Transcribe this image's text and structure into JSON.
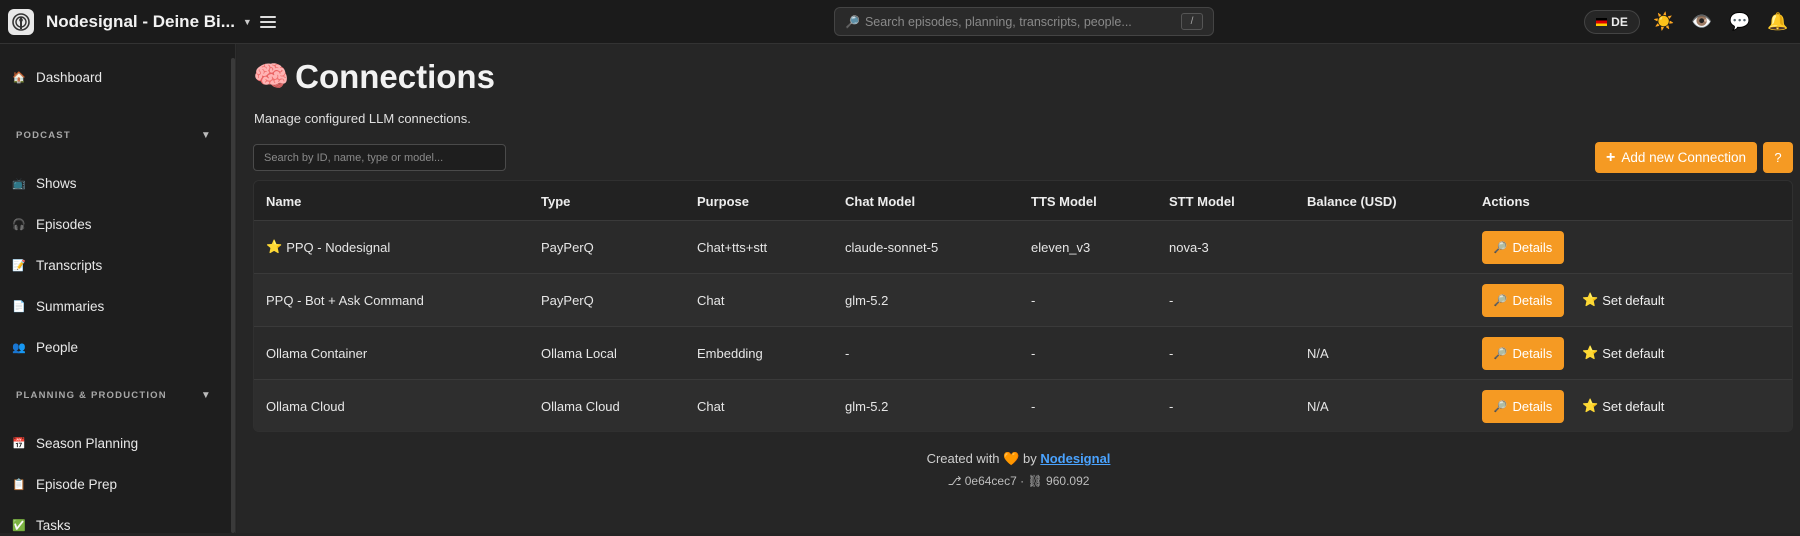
{
  "app": {
    "title": "Nodesignal - Deine Bi...",
    "language": "DE"
  },
  "search": {
    "placeholder": "Search episodes, planning, transcripts, people...",
    "shortcut": "/"
  },
  "sidebar": {
    "dashboard": "Dashboard",
    "sections": [
      {
        "title": "PODCAST",
        "items": [
          "Shows",
          "Episodes",
          "Transcripts",
          "Summaries",
          "People"
        ]
      },
      {
        "title": "PLANNING & PRODUCTION",
        "items": [
          "Season Planning",
          "Episode Prep",
          "Tasks"
        ]
      }
    ]
  },
  "page": {
    "title": "Connections",
    "subtitle": "Manage configured LLM connections.",
    "filter_placeholder": "Search by ID, name, type or model...",
    "add_label": "Add new Connection",
    "help_label": "?"
  },
  "table": {
    "headers": [
      "Name",
      "Type",
      "Purpose",
      "Chat Model",
      "TTS Model",
      "STT Model",
      "Balance (USD)",
      "Actions"
    ],
    "rows": [
      {
        "name": "PPQ - Nodesignal",
        "default": true,
        "type": "PayPerQ",
        "purpose": "Chat+tts+stt",
        "chat_model": "claude-sonnet-5",
        "tts_model": "eleven_v3",
        "stt_model": "nova-3",
        "balance": "",
        "details_label": "Details",
        "set_default_label": ""
      },
      {
        "name": "PPQ - Bot + Ask Command",
        "default": false,
        "type": "PayPerQ",
        "purpose": "Chat",
        "chat_model": "glm-5.2",
        "tts_model": "-",
        "stt_model": "-",
        "balance": "",
        "details_label": "Details",
        "set_default_label": "Set default"
      },
      {
        "name": "Ollama Container",
        "default": false,
        "type": "Ollama Local",
        "purpose": "Embedding",
        "chat_model": "-",
        "tts_model": "-",
        "stt_model": "-",
        "balance": "N/A",
        "details_label": "Details",
        "set_default_label": "Set default"
      },
      {
        "name": "Ollama Cloud",
        "default": false,
        "type": "Ollama Cloud",
        "purpose": "Chat",
        "chat_model": "glm-5.2",
        "tts_model": "-",
        "stt_model": "-",
        "balance": "N/A",
        "details_label": "Details",
        "set_default_label": "Set default"
      }
    ]
  },
  "footer": {
    "created_prefix": "Created with",
    "created_by": "by",
    "author": "Nodesignal",
    "commit": "0e64cec7",
    "separator": "·",
    "build": "960.092"
  },
  "colors": {
    "accent": "#f59a23",
    "link": "#4aa3ff",
    "background": "#262626"
  }
}
